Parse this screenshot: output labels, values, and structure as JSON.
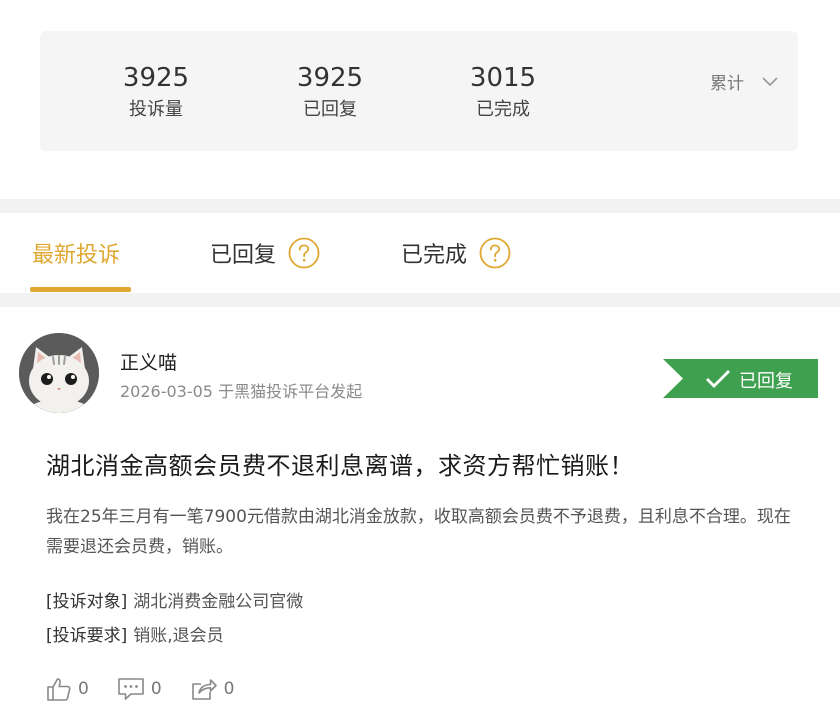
{
  "stats": {
    "items": [
      {
        "value": "3925",
        "label": "投诉量"
      },
      {
        "value": "3925",
        "label": "已回复"
      },
      {
        "value": "3015",
        "label": "已完成"
      }
    ],
    "period": "累计"
  },
  "tabs": [
    {
      "label": "最新投诉",
      "active": true
    },
    {
      "label": "已回复",
      "active": false
    },
    {
      "label": "已完成",
      "active": false
    }
  ],
  "post": {
    "author": "正义喵",
    "meta": "2026-03-05 于黑猫投诉平台发起",
    "status": "已回复",
    "title": "湖北消金高额会员费不退利息离谱，求资方帮忙销账！",
    "body": "我在25年三月有一笔7900元借款由湖北消金放款，收取高额会员费不予退费，且利息不合理。现在需要退还会员费，销账。",
    "fields": [
      {
        "key": "[投诉对象]",
        "value": "湖北消费金融公司官微"
      },
      {
        "key": "[投诉要求]",
        "value": "销账,退会员"
      }
    ],
    "actions": {
      "likes": "0",
      "comments": "0",
      "shares": "0"
    }
  },
  "colors": {
    "accent": "#e0a832",
    "badge": "#3fa14f",
    "panel": "#f5f5f5"
  }
}
